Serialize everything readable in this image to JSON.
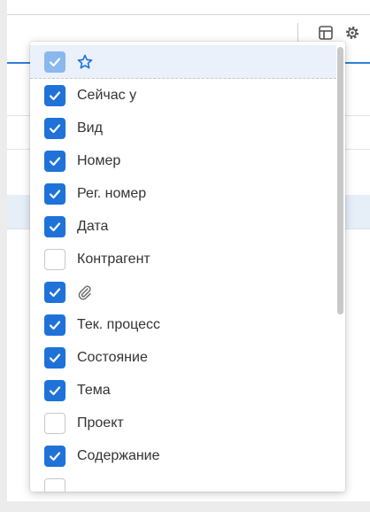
{
  "toolbar": {
    "icons": [
      "layout-icon",
      "gear-icon"
    ]
  },
  "column_menu": {
    "items": [
      {
        "label": "",
        "icon": "star-icon",
        "checked": true
      },
      {
        "label": "Сейчас у",
        "checked": true
      },
      {
        "label": "Вид",
        "checked": true
      },
      {
        "label": "Номер",
        "checked": true
      },
      {
        "label": "Рег. номер",
        "checked": true
      },
      {
        "label": "Дата",
        "checked": true
      },
      {
        "label": "Контрагент",
        "checked": false
      },
      {
        "label": "",
        "icon": "paperclip-icon",
        "checked": true
      },
      {
        "label": "Тек. процесс",
        "checked": true
      },
      {
        "label": "Состояние",
        "checked": true
      },
      {
        "label": "Тема",
        "checked": true
      },
      {
        "label": "Проект",
        "checked": false
      },
      {
        "label": "Содержание",
        "checked": true
      },
      {
        "label": "",
        "checked": false
      }
    ]
  },
  "colors": {
    "accent": "#1f72d8",
    "highlight": "#eaf1fb"
  }
}
